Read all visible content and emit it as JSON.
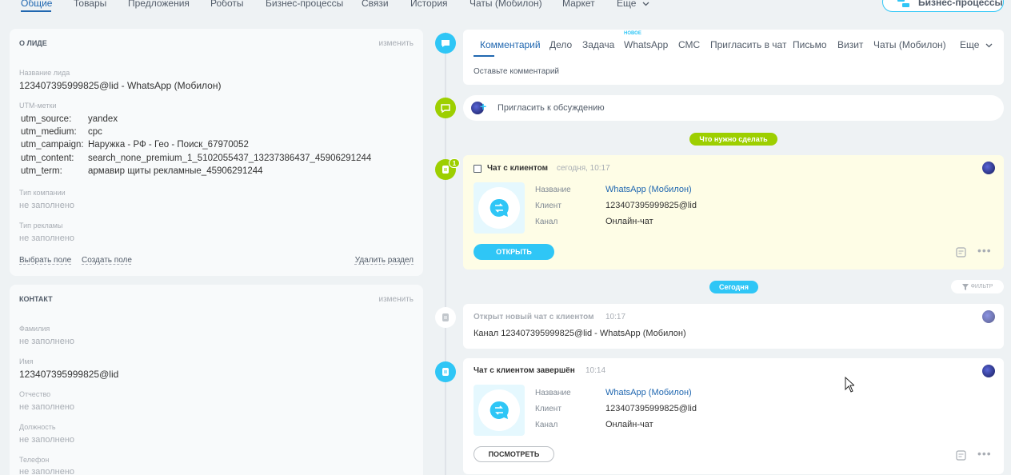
{
  "nav": {
    "tabs": [
      "Общие",
      "Товары",
      "Предложения",
      "Роботы",
      "Бизнес-процессы",
      "Связи",
      "История",
      "Чаты (Мобилон)",
      "Маркет",
      "Еще"
    ],
    "bp_button": "Бизнес-процессы"
  },
  "lead_card": {
    "title": "О ЛИДЕ",
    "edit": "изменить",
    "name_label": "Название лида",
    "name_value": "123407395999825@lid - WhatsApp (Мобилон)",
    "utm_label": "UTM-метки",
    "utm": [
      {
        "key": "utm_source:",
        "value": "yandex"
      },
      {
        "key": "utm_medium:",
        "value": "cpc"
      },
      {
        "key": "utm_campaign:",
        "value": "Наружка - РФ - Гео - Поиск_67970052"
      },
      {
        "key": "utm_content:",
        "value": "search_none_premium_1_5102055437_13237386437_45906291244"
      },
      {
        "key": "utm_term:",
        "value": "армавир щиты рекламные_45906291244"
      }
    ],
    "company_type_label": "Тип компании",
    "company_type_value": "не заполнено",
    "ad_type_label": "Тип рекламы",
    "ad_type_value": "не заполнено",
    "select_field": "Выбрать поле",
    "create_field": "Создать поле",
    "delete_section": "Удалить раздел"
  },
  "contact_card": {
    "title": "КОНТАКТ",
    "edit": "изменить",
    "fields": [
      {
        "label": "Фамилия",
        "value": "не заполнено"
      },
      {
        "label": "Имя",
        "value": "123407395999825@lid"
      },
      {
        "label": "Отчество",
        "value": "не заполнено"
      },
      {
        "label": "Должность",
        "value": "не заполнено"
      },
      {
        "label": "Телефон",
        "value": "не заполнено"
      }
    ]
  },
  "editor": {
    "tabs": [
      "Комментарий",
      "Дело",
      "Задача",
      "WhatsApp",
      "СМС",
      "Пригласить в чат",
      "Письмо",
      "Визит",
      "Чаты (Мобилон)",
      "Еще"
    ],
    "new_badge": "новое",
    "placeholder": "Оставьте комментарий"
  },
  "invite": {
    "text": "Пригласить к обсуждению"
  },
  "todo_pill": "Что нужно сделать",
  "today_pill": "Сегодня",
  "filter": "ФИЛЬТР",
  "chat1": {
    "badge": "1",
    "title": "Чат с клиентом",
    "time": "сегодня, 10:17",
    "name_label": "Название",
    "name_value": "WhatsApp (Мобилон)",
    "client_label": "Клиент",
    "client_value": "123407395999825@lid",
    "channel_label": "Канал",
    "channel_value": "Онлайн-чат",
    "button": "ОТКРЫТЬ"
  },
  "opened": {
    "title": "Открыт новый чат с клиентом",
    "time": "10:17",
    "text": "Канал 123407395999825@lid - WhatsApp (Мобилон)"
  },
  "chat2": {
    "title": "Чат с клиентом завершён",
    "time": "10:14",
    "name_label": "Название",
    "name_value": "WhatsApp (Мобилон)",
    "client_label": "Клиент",
    "client_value": "123407395999825@lid",
    "channel_label": "Канал",
    "channel_value": "Онлайн-чат",
    "button": "ПОСМОТРЕТЬ"
  }
}
